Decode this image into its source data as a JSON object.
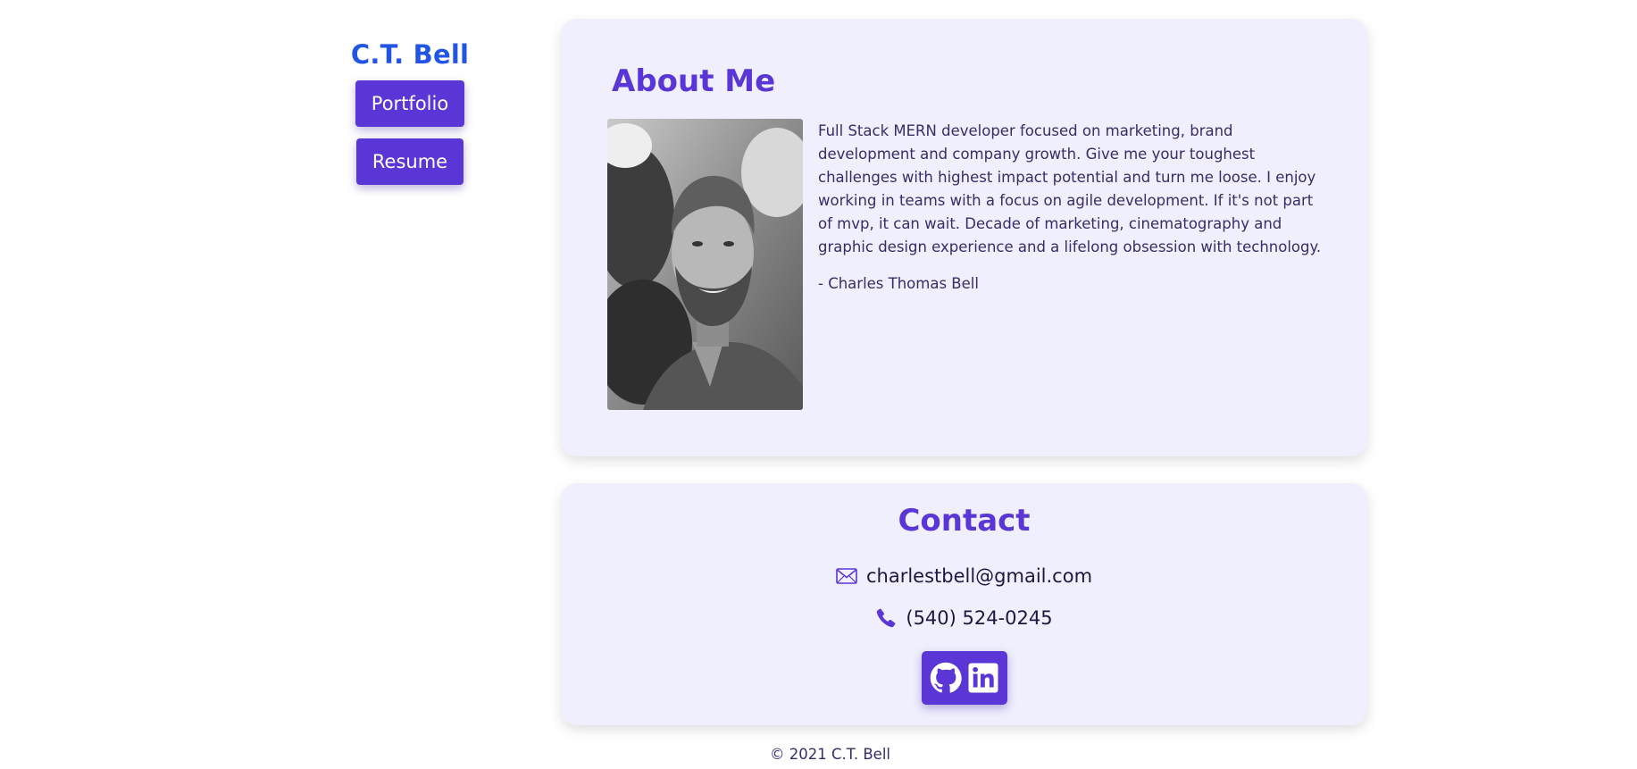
{
  "sidebar": {
    "brand": "C.T. Bell",
    "portfolio_label": "Portfolio",
    "resume_label": "Resume"
  },
  "about": {
    "title": "About Me",
    "text": "Full Stack MERN developer focused on marketing, brand development and company growth. Give me your toughest challenges with highest impact potential and turn me loose. I enjoy working in teams with a focus on agile development. If it's not part of mvp, it can wait. Decade of marketing, cinematography and graphic design experience and a lifelong obsession with technology.",
    "signature": "- Charles Thomas Bell"
  },
  "contact": {
    "title": "Contact",
    "email": "charlestbell@gmail.com",
    "phone": "(540) 524-0245",
    "icons": [
      "mail-icon",
      "phone-icon",
      "github-icon",
      "linkedin-icon"
    ]
  },
  "footer": {
    "text": "© 2021 C.T. Bell"
  },
  "colors": {
    "accent": "#5b36d6",
    "brand": "#2255e6",
    "card_bg": "#efeffd",
    "text": "#3a2c66"
  }
}
